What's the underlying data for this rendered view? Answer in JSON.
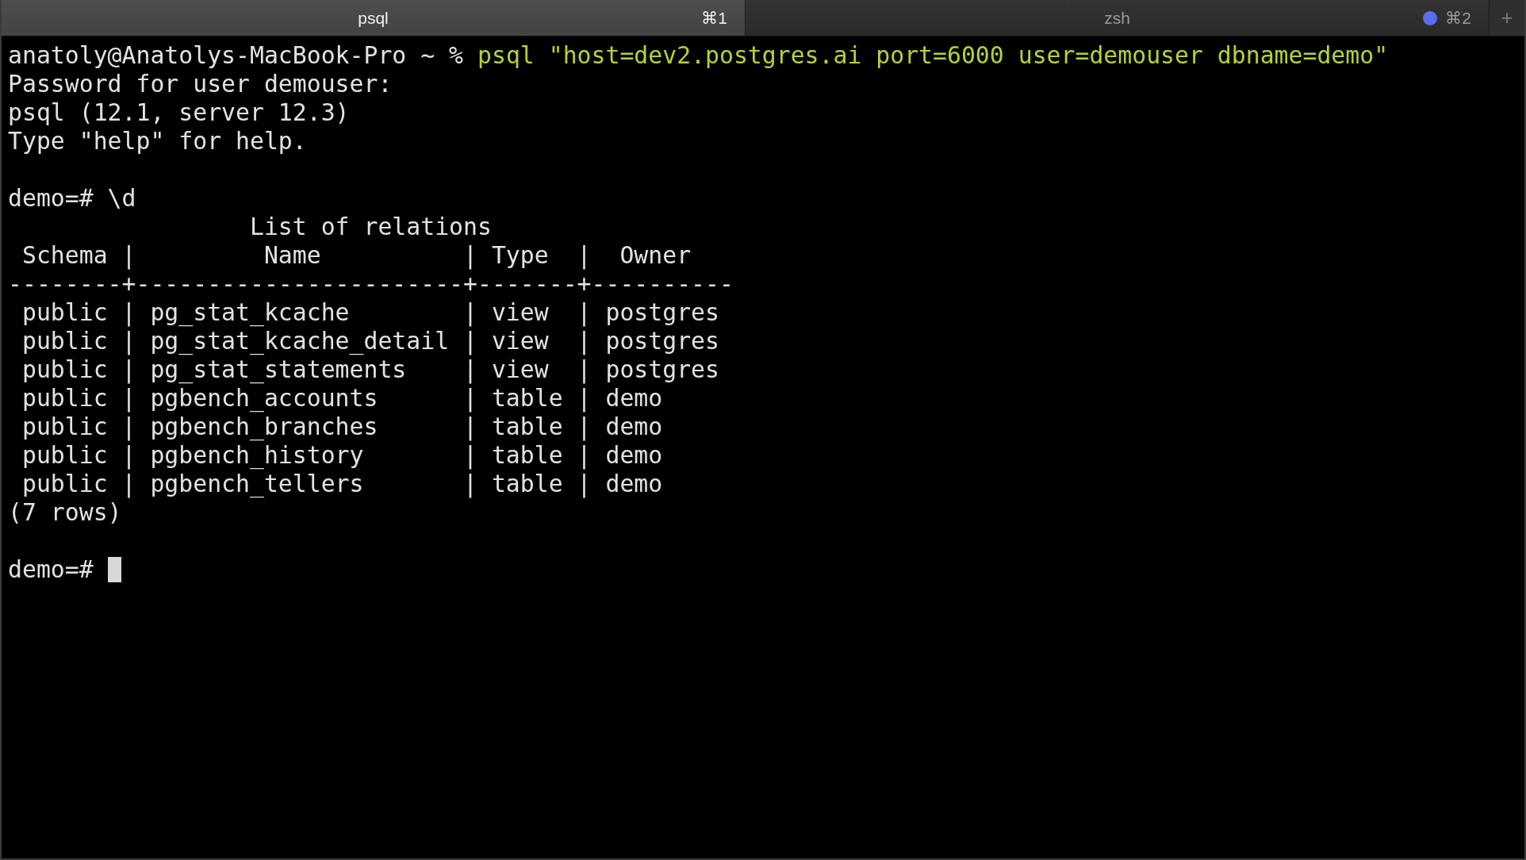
{
  "tabs": [
    {
      "title": "psql",
      "shortcut": "⌘1",
      "selected": true,
      "activity": false
    },
    {
      "title": "zsh",
      "shortcut": "⌘2",
      "selected": false,
      "activity": true
    }
  ],
  "new_tab": "+",
  "terminal": {
    "lines": [
      {
        "kind": "command",
        "prompt": "anatoly@Anatolys-MacBook-Pro ~ % ",
        "command": "psql \"host=dev2.postgres.ai port=6000 user=demouser dbname=demo\""
      },
      {
        "kind": "output",
        "text": "Password for user demouser:"
      },
      {
        "kind": "output",
        "text": "psql (12.1, server 12.3)"
      },
      {
        "kind": "output",
        "text": "Type \"help\" for help."
      },
      {
        "kind": "blank"
      },
      {
        "kind": "output",
        "text": "demo=# \\d"
      },
      {
        "kind": "output",
        "text": "                 List of relations"
      },
      {
        "kind": "output",
        "text": " Schema |         Name          | Type  |  Owner"
      },
      {
        "kind": "output",
        "text": "--------+-----------------------+-------+----------"
      },
      {
        "kind": "output",
        "text": " public | pg_stat_kcache        | view  | postgres"
      },
      {
        "kind": "output",
        "text": " public | pg_stat_kcache_detail | view  | postgres"
      },
      {
        "kind": "output",
        "text": " public | pg_stat_statements    | view  | postgres"
      },
      {
        "kind": "output",
        "text": " public | pgbench_accounts      | table | demo"
      },
      {
        "kind": "output",
        "text": " public | pgbench_branches      | table | demo"
      },
      {
        "kind": "output",
        "text": " public | pgbench_history       | table | demo"
      },
      {
        "kind": "output",
        "text": " public | pgbench_tellers       | table | demo"
      },
      {
        "kind": "output",
        "text": "(7 rows)"
      },
      {
        "kind": "blank"
      },
      {
        "kind": "input",
        "prompt": "demo=# ",
        "cursor": true
      }
    ]
  }
}
